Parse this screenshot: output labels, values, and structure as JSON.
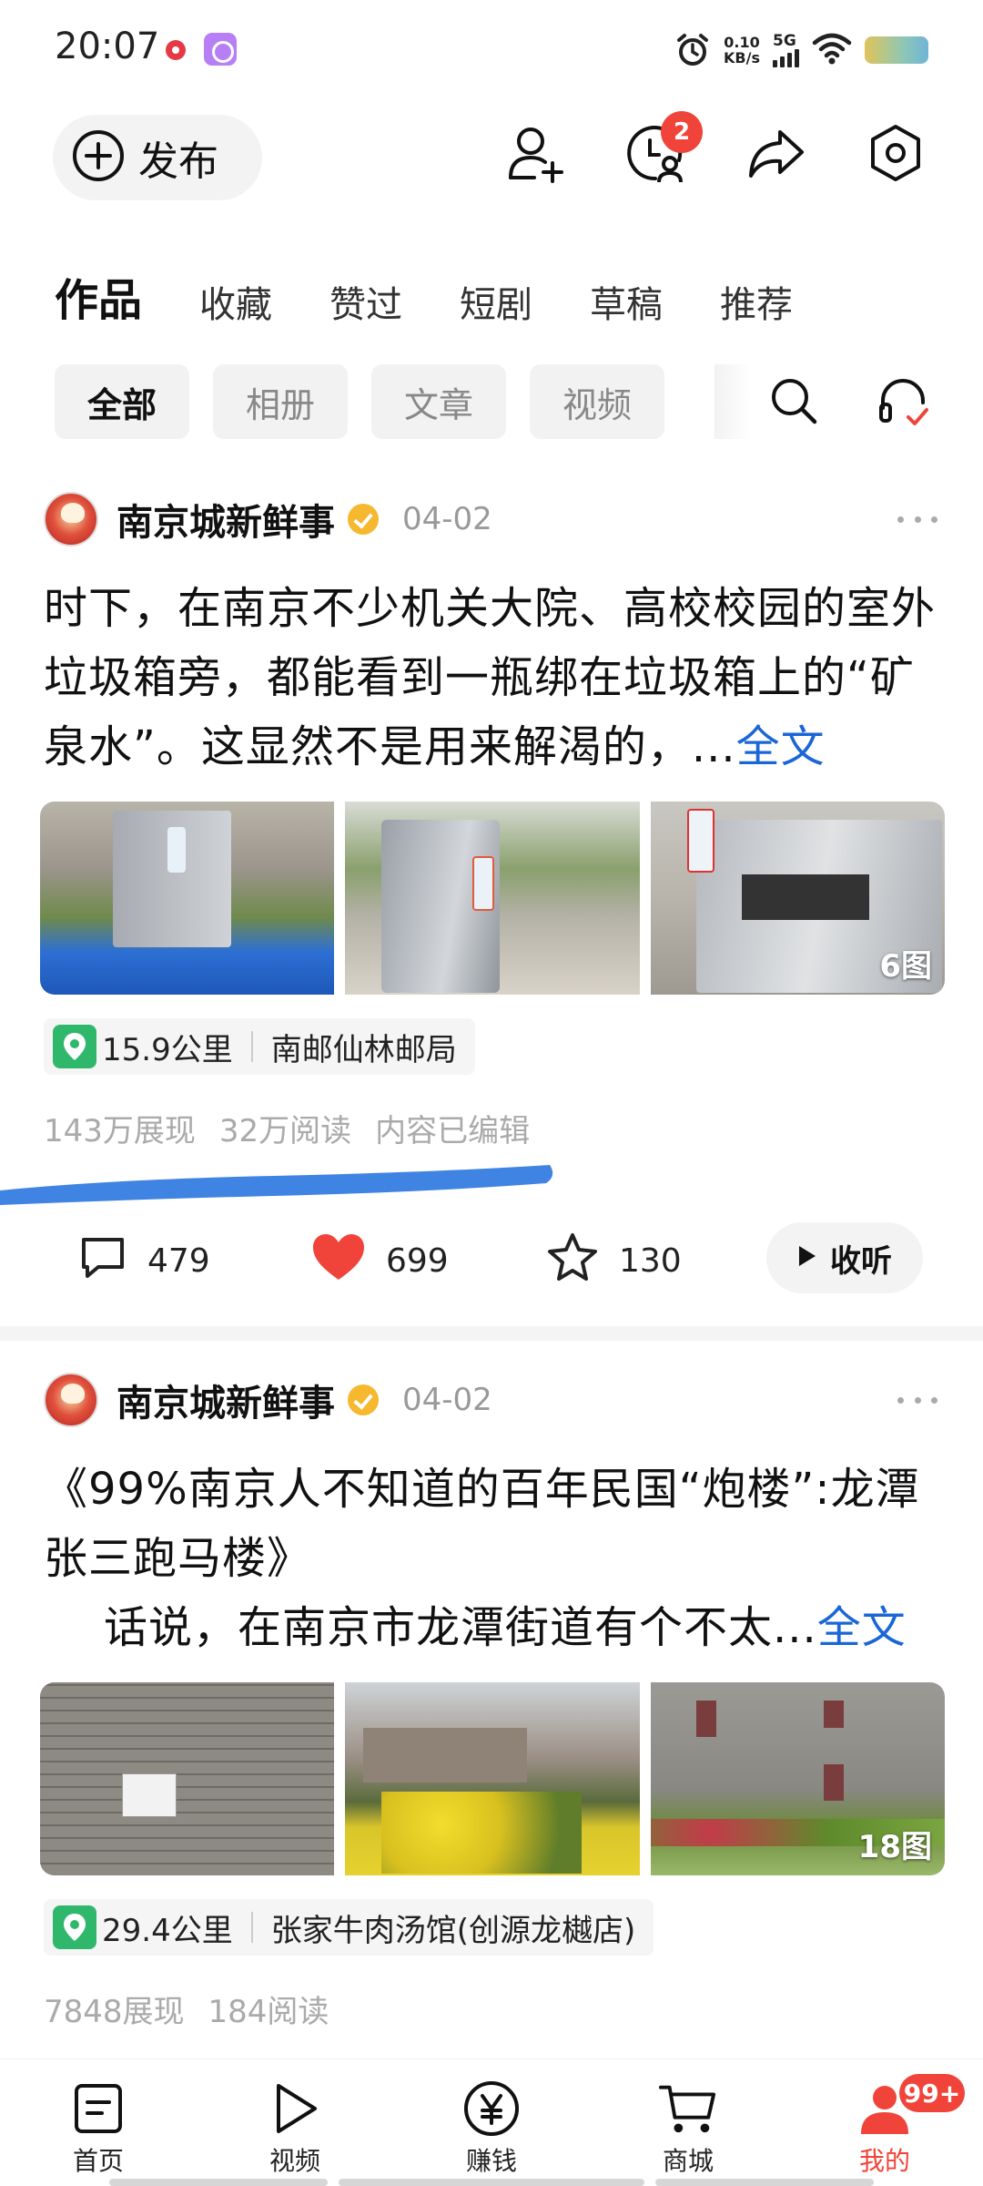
{
  "status_bar": {
    "time": "20:07",
    "net_speed_value": "0.10",
    "net_speed_unit": "KB/s",
    "network": "5G"
  },
  "header": {
    "publish_label": "发布",
    "messages_badge": "2"
  },
  "tabs": [
    "作品",
    "收藏",
    "赞过",
    "短剧",
    "草稿",
    "推荐"
  ],
  "filters": [
    "全部",
    "相册",
    "文章",
    "视频"
  ],
  "posts": [
    {
      "author": "南京城新鲜事",
      "date": "04-02",
      "text": "时下，在南京不少机关大院、高校校园的室外垃圾箱旁，都能看到一瓶绑在垃圾箱上的“矿泉水”。这显然不是用来解渴的，...",
      "fulltext_label": "全文",
      "photo_count": "6图",
      "location_distance": "15.9公里",
      "location_name": "南邮仙林邮局",
      "stats": [
        "143万展现",
        "32万阅读",
        "内容已编辑"
      ],
      "comments": "479",
      "likes": "699",
      "favorites": "130",
      "listen_label": "收听"
    },
    {
      "author": "南京城新鲜事",
      "date": "04-02",
      "title": "《99%南京人不知道的百年民国“炮楼”:龙潭张三跑马楼》",
      "text": "话说，在南京市龙潭街道有个不太...",
      "fulltext_label": "全文",
      "photo_count": "18图",
      "location_distance": "29.4公里",
      "location_name": "张家牛肉汤馆(创源龙樾店)",
      "stats": [
        "7848展现",
        "184阅读"
      ]
    }
  ],
  "bottom_nav": [
    {
      "label": "首页",
      "icon": "home-icon"
    },
    {
      "label": "视频",
      "icon": "video-icon"
    },
    {
      "label": "赚钱",
      "icon": "yen-icon"
    },
    {
      "label": "商城",
      "icon": "cart-icon"
    },
    {
      "label": "我的",
      "icon": "profile-icon",
      "badge": "99+"
    }
  ],
  "colors": {
    "accent_red": "#f0443a",
    "link_blue": "#1a66d6",
    "location_green": "#2fb86b",
    "scribble_blue": "#3f83e3"
  }
}
